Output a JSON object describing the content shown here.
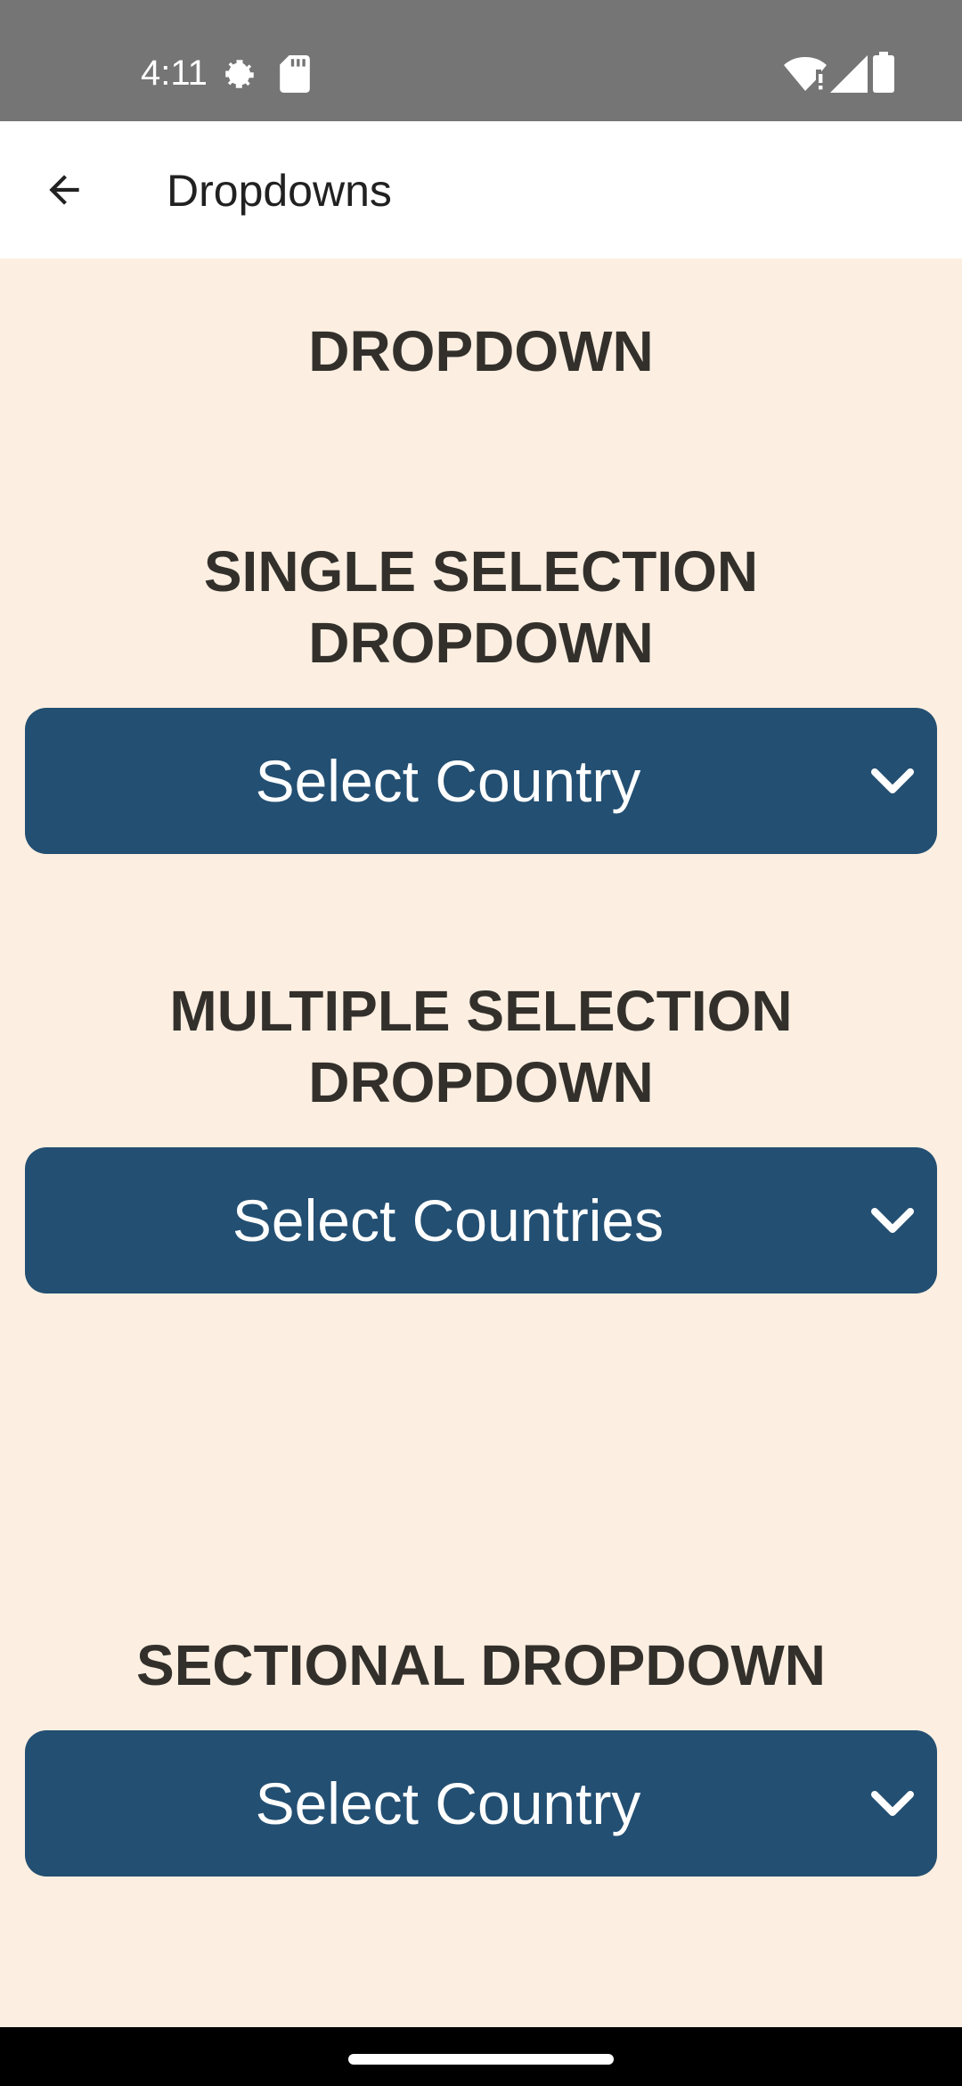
{
  "status_bar": {
    "time": "4:11",
    "icons": [
      "settings-gear-icon",
      "sd-card-icon",
      "wifi-alert-icon",
      "signal-icon",
      "battery-icon"
    ]
  },
  "app_bar": {
    "title": "Dropdowns",
    "back_icon": "arrow-back-icon"
  },
  "main": {
    "page_heading": "DROPDOWN",
    "single": {
      "heading_line1": "SINGLE SELECTION",
      "heading_line2": "DROPDOWN",
      "placeholder": "Select Country"
    },
    "multiple": {
      "heading_line1": "MULTIPLE SELECTION",
      "heading_line2": "DROPDOWN",
      "placeholder": "Select Countries"
    },
    "sectional": {
      "heading": "SECTIONAL DROPDOWN",
      "placeholder": "Select Country"
    }
  },
  "colors": {
    "background": "#fcefe1",
    "dropdown": "#234f72",
    "heading_text": "#33302c",
    "status_bar": "#757575"
  }
}
